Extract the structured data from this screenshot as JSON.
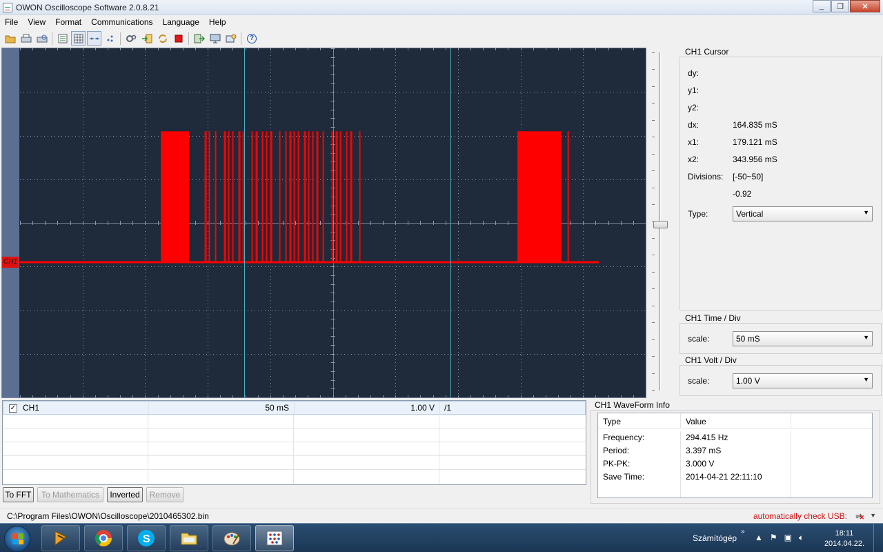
{
  "window": {
    "title": "OWON Oscilloscope Software 2.0.8.21",
    "minimize_label": "_",
    "maximize_label": "❐",
    "close_label": "✕"
  },
  "menu": [
    "File",
    "View",
    "Format",
    "Communications",
    "Language",
    "Help"
  ],
  "toolbar": {
    "icons": [
      "open-icon",
      "print-icon",
      "print-preview-icon",
      "list-icon",
      "grid-icon",
      "dots-icon",
      "points-icon",
      "settings-icon",
      "import-icon",
      "refresh-icon",
      "stop-icon",
      "export-icon",
      "screen-icon",
      "capture-icon",
      "help-icon"
    ],
    "help_label": "?"
  },
  "scope": {
    "channel_marker": "CH1",
    "trace_color": "#ff0000",
    "background_color": "#1f2a3a",
    "cursor_color": "#4fb0c6",
    "time_per_div_ms": 50,
    "cursor_x1_ms": 179.121,
    "cursor_x2_ms": 343.956,
    "signal": {
      "low_level_v": 0,
      "high_level_v": 3.0,
      "burst_1_ms": [
        [
          112.5,
          135
        ],
        [
          147.5,
          272.5
        ]
      ],
      "burst_2_ms": [
        [
          397.5,
          432.5
        ]
      ],
      "trace_end_ms": 462.5
    }
  },
  "cursor_panel": {
    "title": "CH1 Cursor",
    "dy_label": "dy:",
    "dy_value": "",
    "y1_label": "y1:",
    "y1_value": "",
    "y2_label": "y2:",
    "y2_value": "",
    "dx_label": "dx:",
    "dx_value": "164.835 mS",
    "x1_label": "x1:",
    "x1_value": "179.121 mS",
    "x2_label": "x2:",
    "x2_value": "343.956 mS",
    "divisions_label": "Divisions:",
    "divisions_range": "[-50~50]",
    "divisions_value": "-0.92",
    "type_label": "Type:",
    "type_value": "Vertical"
  },
  "time_panel": {
    "title": "CH1 Time / Div",
    "scale_label": "scale:",
    "scale_value": "50 mS"
  },
  "volt_panel": {
    "title": "CH1 Volt / Div",
    "scale_label": "scale:",
    "scale_value": "1.00 V"
  },
  "channel_table": {
    "rows": [
      {
        "checked": "✓",
        "name": "CH1",
        "time": "50 mS",
        "volt": "1.00 V",
        "ratio": "/1"
      }
    ]
  },
  "buttons": {
    "to_fft": "To FFT",
    "to_math": "To Mathematics",
    "inverted": "Inverted",
    "remove": "Remove"
  },
  "waveform_info": {
    "title": "CH1 WaveForm Info",
    "header_type": "Type",
    "header_value": "Value",
    "rows": [
      {
        "type": "Frequency:",
        "value": "294.415 Hz"
      },
      {
        "type": "Period:",
        "value": "3.397 mS"
      },
      {
        "type": "PK-PK:",
        "value": "3.000 V"
      },
      {
        "type": "Save Time:",
        "value": "2014-04-21 22:11:10"
      }
    ]
  },
  "statusbar": {
    "path": "C:\\Program Files\\OWON\\Oscilloscope\\2010465302.bin",
    "usb_status": "automatically check USB:"
  },
  "taskbar": {
    "apps": [
      "winamp-icon",
      "chrome-icon",
      "skype-icon",
      "explorer-icon",
      "paint-icon",
      "oscilloscope-icon"
    ],
    "tray_label": "Számítógép",
    "time": "18:11",
    "date": "2014.04.22."
  }
}
